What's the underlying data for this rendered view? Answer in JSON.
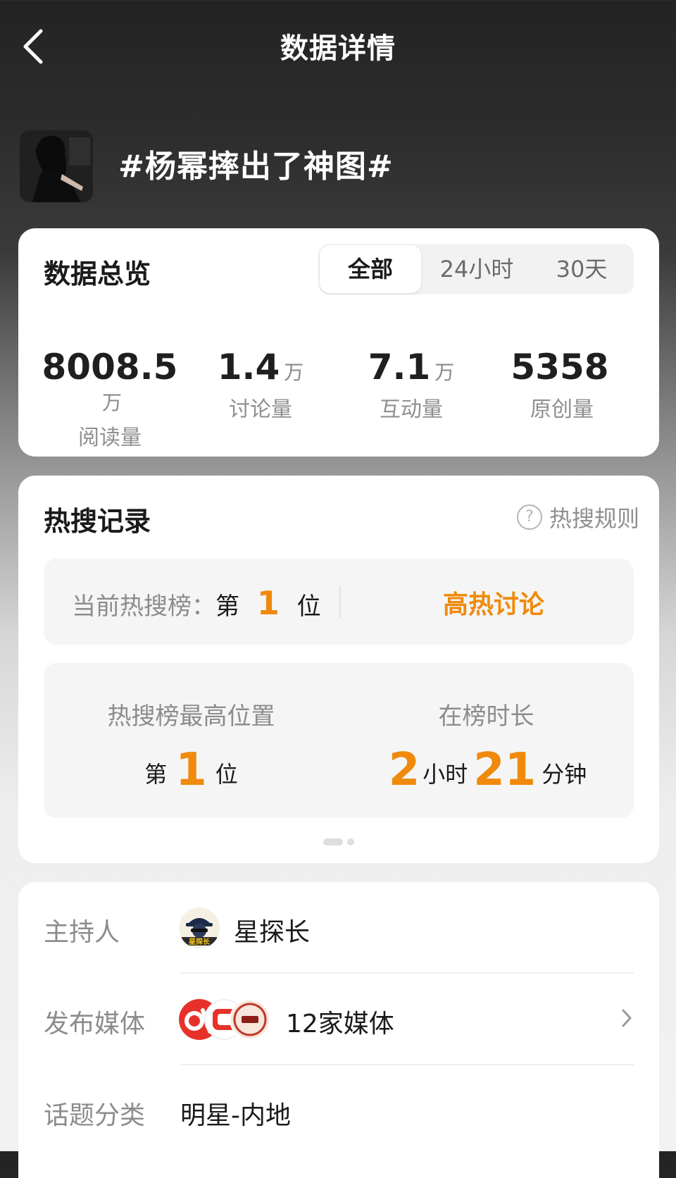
{
  "header": {
    "title": "数据详情",
    "back_icon": "chevron-left-icon"
  },
  "topic": {
    "title": "#杨幂摔出了神图#"
  },
  "overview": {
    "title": "数据总览",
    "tabs": [
      {
        "label": "全部",
        "active": true
      },
      {
        "label": "24小时",
        "active": false
      },
      {
        "label": "30天",
        "active": false
      }
    ],
    "stats": [
      {
        "value": "8008.5",
        "unit": "万",
        "label": "阅读量"
      },
      {
        "value": "1.4",
        "unit": "万",
        "label": "讨论量"
      },
      {
        "value": "7.1",
        "unit": "万",
        "label": "互动量"
      },
      {
        "value": "5358",
        "unit": "",
        "label": "原创量"
      }
    ]
  },
  "hot_search": {
    "title": "热搜记录",
    "rules_label": "热搜规则",
    "current_prefix": "当前热搜榜：",
    "current_pre": "第",
    "current_rank": "1",
    "current_post": "位",
    "tag": "高热讨论",
    "peak_label": "热搜榜最高位置",
    "peak_pre": "第",
    "peak_rank": "1",
    "peak_post": "位",
    "duration_label": "在榜时长",
    "duration_hours": "2",
    "duration_hours_unit": "小时",
    "duration_minutes": "21",
    "duration_minutes_unit": "分钟"
  },
  "info": {
    "host_label": "主持人",
    "host_name": "星探长",
    "media_label": "发布媒体",
    "media_value": "12家媒体",
    "category_label": "话题分类",
    "category_value": "明星-内地"
  },
  "colors": {
    "accent": "#ef8a0c",
    "card": "#ffffff"
  }
}
